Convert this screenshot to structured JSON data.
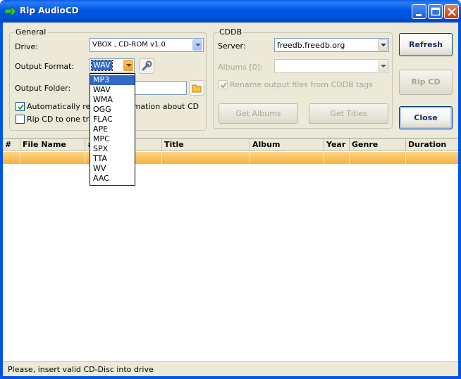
{
  "window": {
    "title": "Rip AudioCD"
  },
  "general": {
    "group_title": "General",
    "drive_label": "Drive:",
    "drive_value": "VBOX    , CD-ROM       v1.0",
    "format_label": "Output Format:",
    "format_value": "WAV",
    "folder_label": "Output Folder:",
    "auto_retrieve_label": "Automatically retrieve information about CD",
    "auto_retrieve_checked": true,
    "rip_one_track_label": "Rip CD to one track",
    "rip_one_track_checked": false
  },
  "format_dropdown": {
    "options": [
      "MP3",
      "WAV",
      "WMA",
      "OGG",
      "FLAC",
      "APE",
      "MPC",
      "SPX",
      "TTA",
      "WV",
      "AAC"
    ],
    "highlighted": "MP3"
  },
  "cddb": {
    "group_title": "CDDB",
    "server_label": "Server:",
    "server_value": "freedb.freedb.org",
    "albums_label": "Albums [0]:",
    "albums_value": "",
    "rename_label": "Rename output files from CDDB tags",
    "rename_checked": true,
    "get_albums_label": "Get Albums",
    "get_titles_label": "Get Titles"
  },
  "buttons": {
    "refresh": "Refresh",
    "rip_cd": "Rip CD",
    "close": "Close"
  },
  "table": {
    "columns": [
      "#",
      "File Name",
      "#",
      "Title",
      "Album",
      "Year",
      "Genre",
      "Duration"
    ]
  },
  "status": {
    "text": "Please, insert valid CD-Disc into drive"
  }
}
